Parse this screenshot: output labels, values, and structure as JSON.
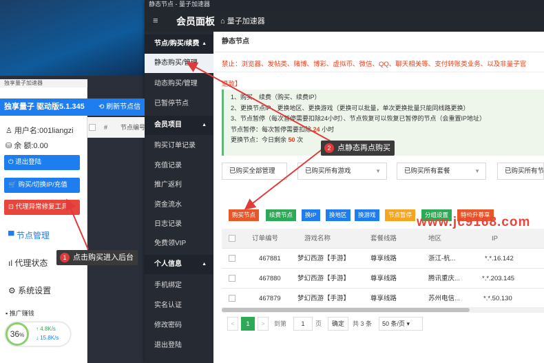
{
  "window_title": "静态节点 - 量子加速器",
  "topbar": {
    "title": "会员面板",
    "home": "量子加速器"
  },
  "nav": [
    "节点/购买/续费",
    "静态购买/管理",
    "动态购买/管理",
    "已暂停节点",
    "会员项目",
    "购买订单记录",
    "充值记录",
    "推广返利",
    "资金流水",
    "日志记录",
    "免费领VIP",
    "个人信息",
    "手机绑定",
    "实名认证",
    "修改密码",
    "退出登陆"
  ],
  "main": {
    "breadcrumb": "静态节点",
    "warning": "禁止：浏览器、发帖类、赌博、博彩、虚拟币、微信、QQ、聊天相关等、支付转账类业务、以及非量子官",
    "refund": "退款】",
    "notice": [
      "1、购买、续费（购买、续费IP）",
      "2、更换节点IP、更换地区、更换游戏（更换可以批量，单次更换批量只能同线路更换）",
      "3、节点暂停（每次暂停需要扣除24小时）、节点恢复可以恢复已暂停的节点（会重置IP地址）"
    ],
    "pause_pre": "节点暂停：每次暂停需要扣除",
    "pause_num": "24",
    "pause_post": "小时",
    "change_pre": "更换节点：今日剩余",
    "change_num": "50",
    "change_post": "次",
    "filters": [
      "已购买全部管理",
      "已购买所有游戏",
      "已购买所有套餐",
      "已购买所有节"
    ],
    "watermark": "www.jc9168.com",
    "buttons": [
      {
        "label": "购买节点",
        "color": "#e8572a"
      },
      {
        "label": "续费节点",
        "color": "#2eaa56"
      },
      {
        "label": "换IP",
        "color": "#1e7ef0"
      },
      {
        "label": "换地区",
        "color": "#1e7ef0"
      },
      {
        "label": "换游戏",
        "color": "#1e7ef0"
      },
      {
        "label": "节点暂停",
        "color": "#f4a622"
      },
      {
        "label": "分组设置",
        "color": "#2eaa56"
      },
      {
        "label": "特价升尊享",
        "color": "#e8572a"
      }
    ],
    "columns": [
      "订单编号",
      "游戏名称",
      "套餐线路",
      "地区",
      "IP"
    ],
    "rows": [
      [
        "467881",
        "梦幻西游【手游】",
        "尊享线路",
        "浙江-杭...",
        "*.*.16.142"
      ],
      [
        "467880",
        "梦幻西游【手游】",
        "尊享线路",
        "腾讯重庆...",
        "*.*.203.145"
      ],
      [
        "467879",
        "梦幻西游【手游】",
        "尊享线路",
        "苏州电信...",
        "*.*.50.130"
      ]
    ],
    "pager": {
      "page": "1",
      "goto": "到第",
      "page_input": "1",
      "page_unit": "页",
      "confirm": "确定",
      "total": "共 3 条",
      "size": "50 条/页"
    }
  },
  "client": {
    "title": "独享量子加速器",
    "app": "独享量子 驱动版5.1.345",
    "refresh": "刷新节点信",
    "user": "用户名:001liangzi",
    "balance": "余  额:0.00",
    "logout": "退出登陆",
    "buy": "购买/切换IP/充值",
    "proxy": "代理异常修复工具",
    "menu1": "节点管理",
    "menu2": "代理状态",
    "menu3": "系统设置",
    "promo": "推广赚钱",
    "col_hash": "#",
    "col_node": "节点编号",
    "gauge": "36",
    "gauge_unit": "%",
    "up": "4.8K/s",
    "down": "15.8K/s"
  },
  "tips": {
    "t1": "点击购买进入后台",
    "t2": "点静态再点购买"
  }
}
